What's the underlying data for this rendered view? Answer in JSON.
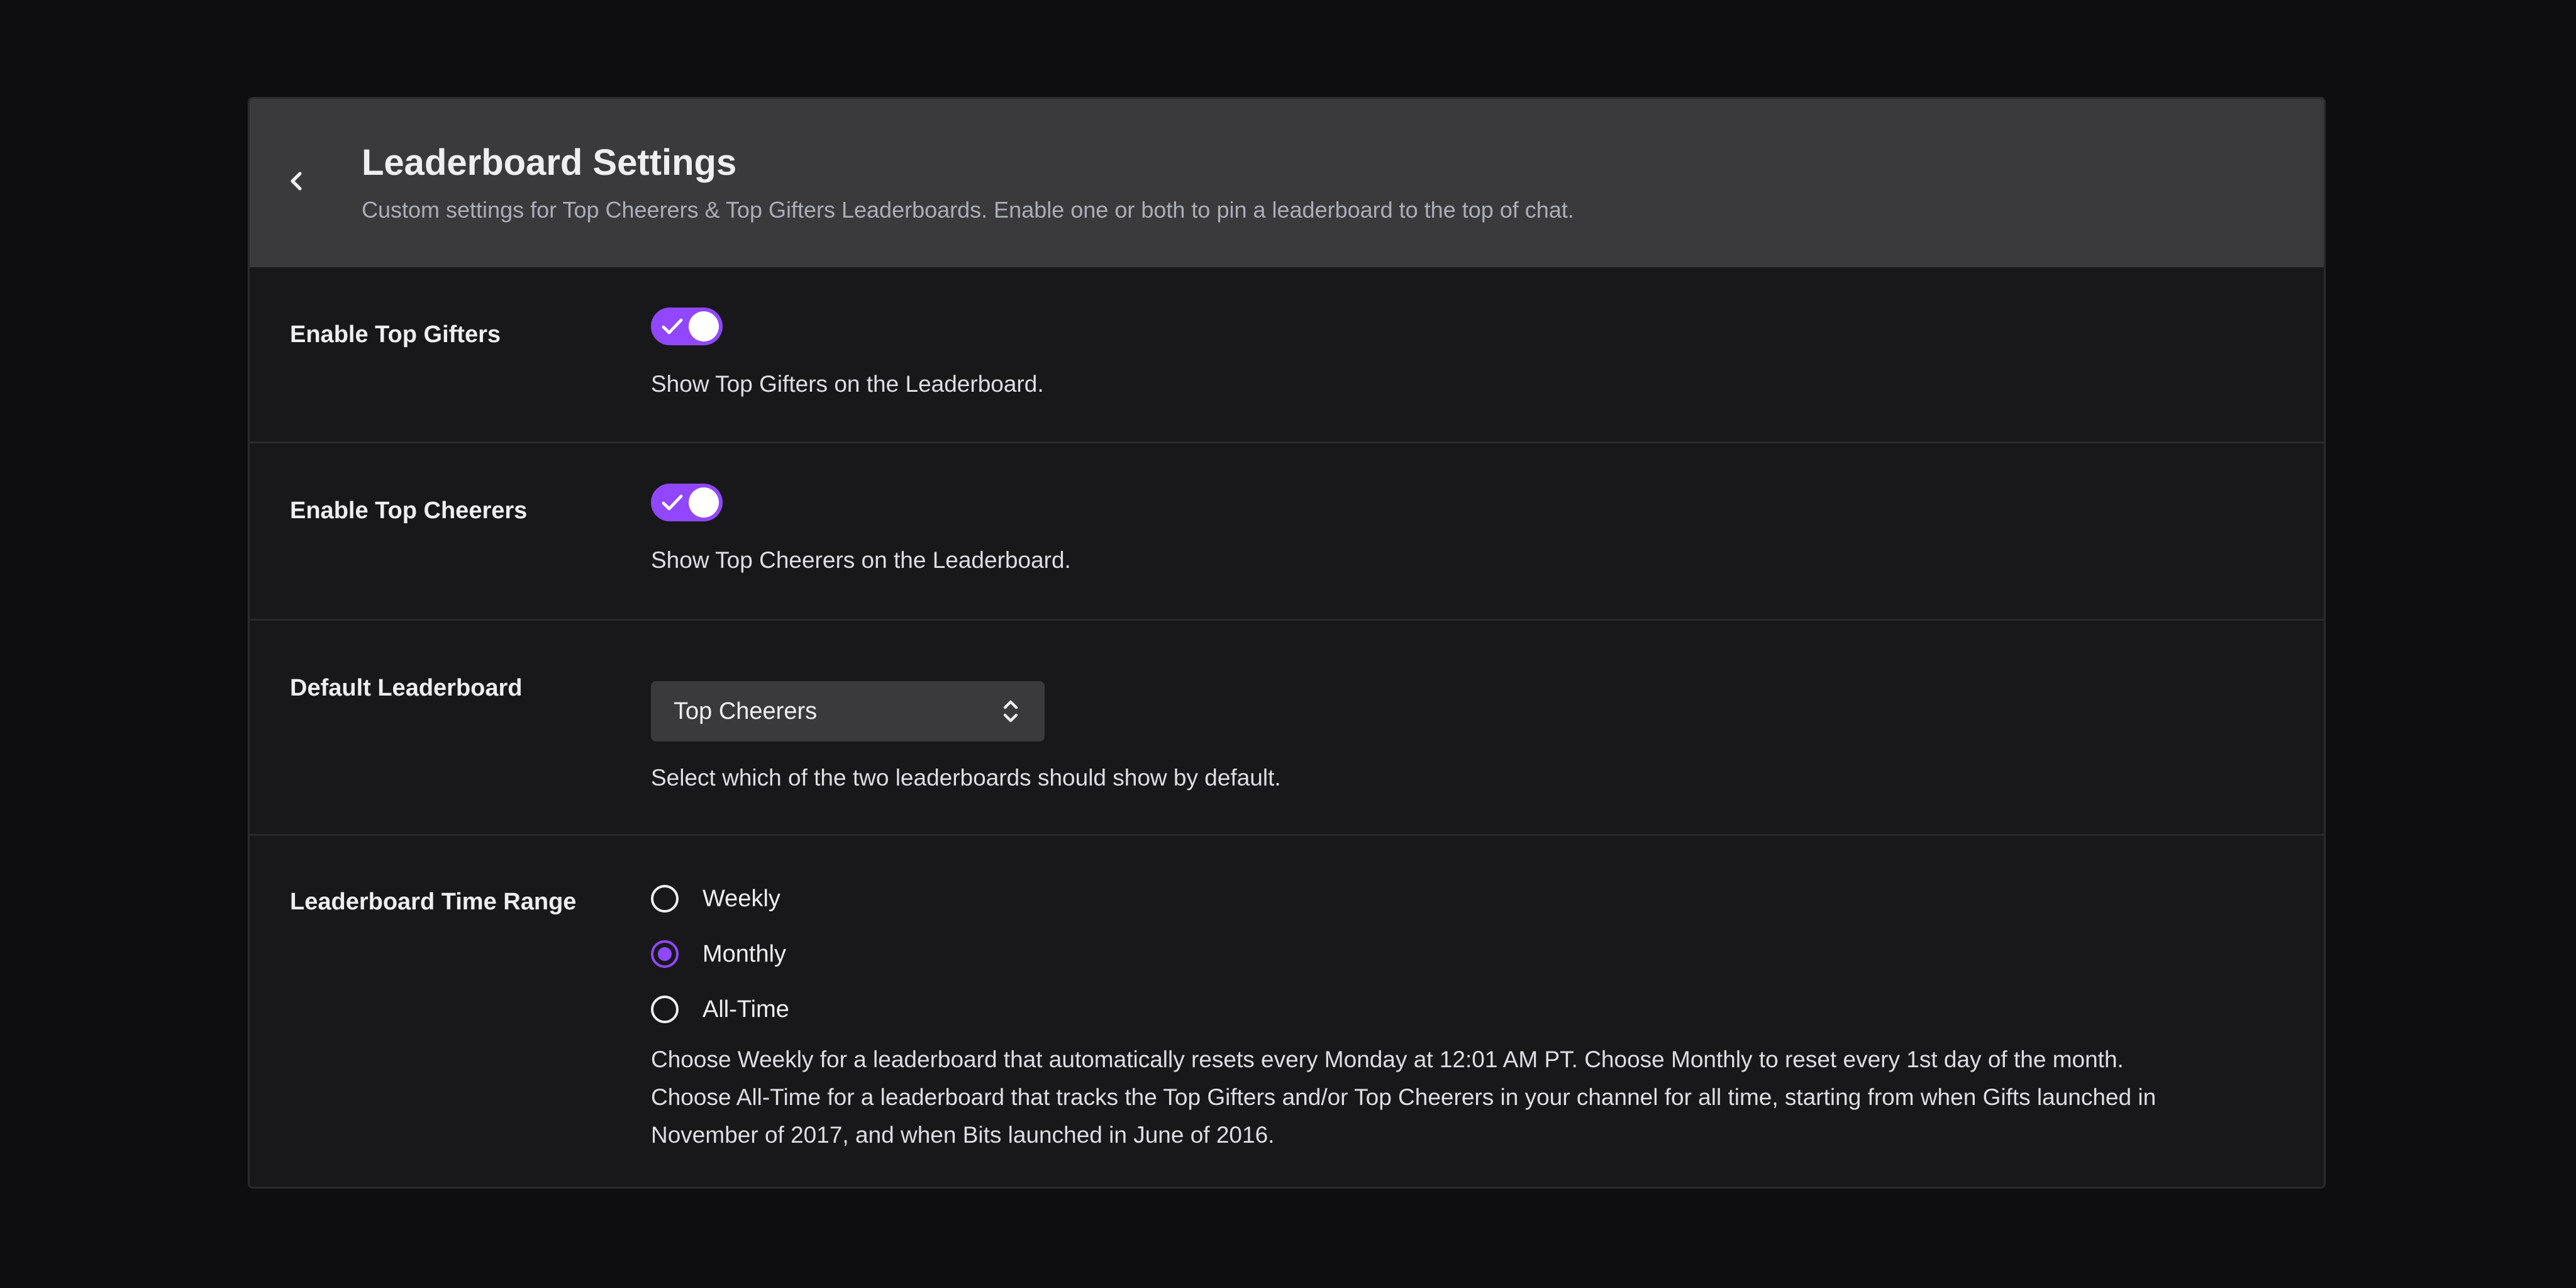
{
  "header": {
    "title": "Leaderboard Settings",
    "subtitle": "Custom settings for Top Cheerers & Top Gifters Leaderboards. Enable one or both to pin a leaderboard to the top of chat."
  },
  "rows": {
    "top_gifters": {
      "label": "Enable Top Gifters",
      "enabled": true,
      "description": "Show Top Gifters on the Leaderboard."
    },
    "top_cheerers": {
      "label": "Enable Top Cheerers",
      "enabled": true,
      "description": "Show Top Cheerers on the Leaderboard."
    },
    "default_leaderboard": {
      "label": "Default Leaderboard",
      "selected": "Top Cheerers",
      "description": "Select which of the two leaderboards should show by default."
    },
    "time_range": {
      "label": "Leaderboard Time Range",
      "options": [
        "Weekly",
        "Monthly",
        "All-Time"
      ],
      "selected": "Monthly",
      "description_lines": [
        "Choose Weekly for a leaderboard that automatically resets every Monday at 12:01 AM PT. Choose Monthly to reset every 1st day of the month.",
        "Choose All-Time for a leaderboard that tracks the Top Gifters and/or Top Cheerers in your channel for all time, starting from when Gifts launched in",
        "November of 2017, and when Bits launched in June of 2016."
      ]
    }
  },
  "colors": {
    "accent": "#9147ff",
    "background": "#0e0e10",
    "panel": "#18181b",
    "header": "#3a3a3d"
  },
  "icons": {
    "back": "chevron-left-icon",
    "toggle_check": "check-icon",
    "select_arrows": "chevron-up-down-icon"
  }
}
